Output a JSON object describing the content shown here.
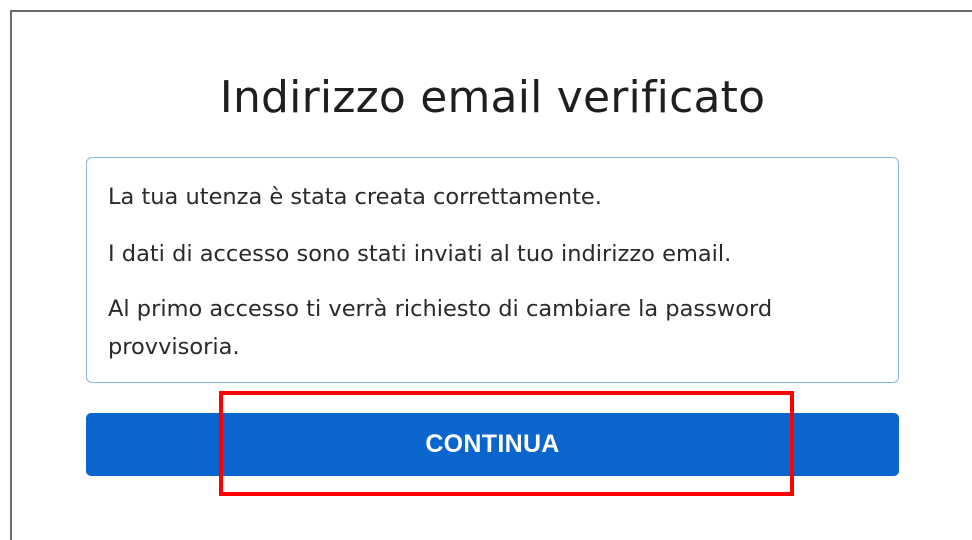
{
  "dialog": {
    "title": "Indirizzo email verificato",
    "message_lines": [
      "La tua utenza è stata creata correttamente.",
      "I dati di accesso sono stati inviati al tuo indirizzo email.",
      "Al primo accesso ti verrà richiesto di cambiare la password provvisoria."
    ],
    "continue_label": "CONTINUA"
  },
  "colors": {
    "button_bg": "#0a66cc",
    "info_border": "#8ab6e6",
    "highlight": "#ff0000"
  }
}
